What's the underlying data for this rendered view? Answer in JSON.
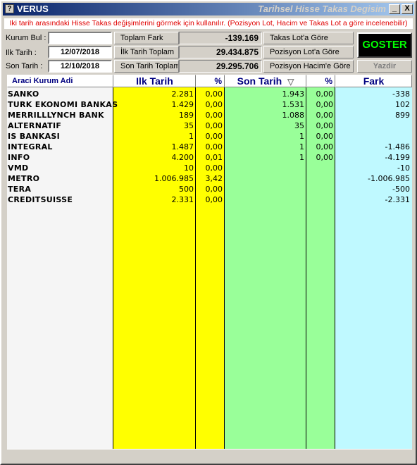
{
  "window": {
    "title": "VERUS",
    "title_right": "Tarihsel Hisse Takas Degisim",
    "buttons": {
      "minimize": "_",
      "maximize": "□",
      "close": "X"
    }
  },
  "info_text": "Iki tarih arasındaki Hisse Takas değişimlerini görmek için kullanılır. (Pozisyon Lot, Hacim ve Takas Lot a göre incelenebilir)",
  "form": {
    "kurum_bul_label": "Kurum Bul :",
    "kurum_bul_value": "",
    "ilk_tarih_label": "Ilk Tarih     :",
    "ilk_tarih_value": "12/07/2018",
    "son_tarih_label": "Son Tarih    :",
    "son_tarih_value": "12/10/2018"
  },
  "summary": {
    "toplam_fark_label": "Toplam Fark",
    "toplam_fark_value": "-139.169",
    "ilk_tarih_toplam_label": "İlk Tarih Toplam",
    "ilk_tarih_toplam_value": "29.434.875",
    "son_tarih_toplam_label": "Son Tarih Toplam",
    "son_tarih_toplam_value": "29.295.706"
  },
  "mode_buttons": {
    "takas_lot": "Takas Lot'a Göre",
    "pozisyon_lot": "Pozisyon Lot'a Göre",
    "pozisyon_hacim": "Pozisyon Hacim'e Göre"
  },
  "goster_label": "GOSTER",
  "yazdir_label": "Yazdir",
  "grid": {
    "headers": {
      "name": "Araci Kurum Adi",
      "ilk": "Ilk Tarih",
      "ilk_pct": "%",
      "son": "Son Tarih",
      "son_pct": "%",
      "fark": "Fark"
    },
    "sort_indicator": "▽",
    "rows": [
      {
        "name": "SANKO",
        "ilk": "2.281",
        "ilk_pct": "0,00",
        "son": "1.943",
        "son_pct": "0,00",
        "fark": "-338"
      },
      {
        "name": "TURK EKONOMI BANKAS",
        "ilk": "1.429",
        "ilk_pct": "0,00",
        "son": "1.531",
        "son_pct": "0,00",
        "fark": "102"
      },
      {
        "name": "MERRILLLYNCH BANK",
        "ilk": "189",
        "ilk_pct": "0,00",
        "son": "1.088",
        "son_pct": "0,00",
        "fark": "899"
      },
      {
        "name": "ALTERNATIF",
        "ilk": "35",
        "ilk_pct": "0,00",
        "son": "35",
        "son_pct": "0,00",
        "fark": ""
      },
      {
        "name": "IS BANKASI",
        "ilk": "1",
        "ilk_pct": "0,00",
        "son": "1",
        "son_pct": "0,00",
        "fark": ""
      },
      {
        "name": "INTEGRAL",
        "ilk": "1.487",
        "ilk_pct": "0,00",
        "son": "1",
        "son_pct": "0,00",
        "fark": "-1.486"
      },
      {
        "name": "INFO",
        "ilk": "4.200",
        "ilk_pct": "0,01",
        "son": "1",
        "son_pct": "0,00",
        "fark": "-4.199"
      },
      {
        "name": "VMD",
        "ilk": "10",
        "ilk_pct": "0,00",
        "son": "",
        "son_pct": "",
        "fark": "-10"
      },
      {
        "name": "METRO",
        "ilk": "1.006.985",
        "ilk_pct": "3,42",
        "son": "",
        "son_pct": "",
        "fark": "-1.006.985"
      },
      {
        "name": "TERA",
        "ilk": "500",
        "ilk_pct": "0,00",
        "son": "",
        "son_pct": "",
        "fark": "-500"
      },
      {
        "name": "CREDITSUISSE",
        "ilk": "2.331",
        "ilk_pct": "0,00",
        "son": "",
        "son_pct": "",
        "fark": "-2.331"
      }
    ]
  },
  "colors": {
    "ilk_column": "#ffff00",
    "son_column": "#99ff99",
    "fark_column": "#bff9ff",
    "info_text": "#e00000",
    "goster_text": "#00ff00"
  }
}
